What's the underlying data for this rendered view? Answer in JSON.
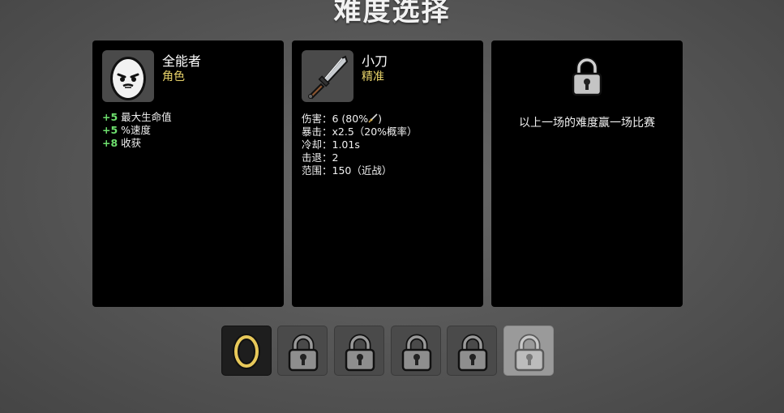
{
  "title": "难度选择",
  "character": {
    "name": "全能者",
    "type_label": "角色",
    "portrait_icon": "potato-face-icon",
    "stats": [
      {
        "bonus": "+5",
        "label": "最大生命值"
      },
      {
        "bonus": "+5",
        "label": "%速度"
      },
      {
        "bonus": "+8",
        "label": "收获"
      }
    ]
  },
  "weapon": {
    "name": "小刀",
    "type_label": "精准",
    "icon": "knife-icon",
    "stats": {
      "damage": "伤害：6 (80%",
      "damage_close": ")",
      "crit": "暴击：x2.5（20%概率）",
      "cooldown": "冷却：1.01s",
      "knockback": "击退：2",
      "range": "范围：150（近战）"
    }
  },
  "difficulty": {
    "icon": "padlock-icon",
    "text": "以上一场的难度赢一场比赛"
  },
  "slots": [
    {
      "icon": "ring-icon",
      "state": "selected"
    },
    {
      "icon": "padlock-icon",
      "state": "locked"
    },
    {
      "icon": "padlock-icon",
      "state": "locked"
    },
    {
      "icon": "padlock-icon",
      "state": "locked"
    },
    {
      "icon": "padlock-icon",
      "state": "locked"
    },
    {
      "icon": "padlock-icon",
      "state": "locked-highlighted"
    }
  ],
  "colors": {
    "stat_bonus": "#6ee06e",
    "subtitle": "#e8d36a",
    "ring": "#e8c95a"
  }
}
